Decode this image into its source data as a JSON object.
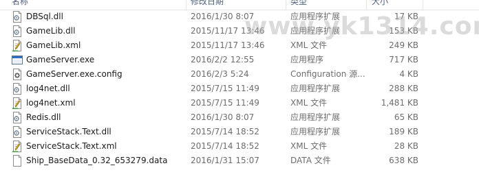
{
  "columns": {
    "name": "名称",
    "date": "修改日期",
    "type": "类型",
    "size": "大小"
  },
  "files": [
    {
      "icon": "dll-file-icon",
      "name": "DBSql.dll",
      "date": "2016/1/30 8:07",
      "type": "应用程序扩展",
      "size": "17 KB"
    },
    {
      "icon": "dll-file-icon",
      "name": "GameLib.dll",
      "date": "2015/11/17 13:46",
      "type": "应用程序扩展",
      "size": "153 KB"
    },
    {
      "icon": "xml-file-icon",
      "name": "GameLib.xml",
      "date": "2015/11/17 13:46",
      "type": "XML 文件",
      "size": "249 KB"
    },
    {
      "icon": "exe-file-icon",
      "name": "GameServer.exe",
      "date": "2016/2/2 12:55",
      "type": "应用程序",
      "size": "717 KB"
    },
    {
      "icon": "config-file-icon",
      "name": "GameServer.exe.config",
      "date": "2016/2/3 5:24",
      "type": "Configuration 源...",
      "size": "4 KB"
    },
    {
      "icon": "dll-file-icon",
      "name": "log4net.dll",
      "date": "2015/7/15 11:49",
      "type": "应用程序扩展",
      "size": "288 KB"
    },
    {
      "icon": "xml-file-icon",
      "name": "log4net.xml",
      "date": "2015/7/15 11:49",
      "type": "XML 文件",
      "size": "1,481 KB"
    },
    {
      "icon": "dll-file-icon",
      "name": "Redis.dll",
      "date": "2016/1/30 8:07",
      "type": "应用程序扩展",
      "size": "65 KB"
    },
    {
      "icon": "dll-file-icon",
      "name": "ServiceStack.Text.dll",
      "date": "2015/7/14 18:52",
      "type": "应用程序扩展",
      "size": "189 KB"
    },
    {
      "icon": "xml-file-icon",
      "name": "ServiceStack.Text.xml",
      "date": "2015/7/14 18:52",
      "type": "XML 文件",
      "size": "28 KB"
    },
    {
      "icon": "data-file-icon",
      "name": "Ship_BaseData_0.32_653279.data",
      "date": "2016/1/31 15:07",
      "type": "DATA 文件",
      "size": "638 KB"
    }
  ],
  "watermark": "www.yk1314.com"
}
